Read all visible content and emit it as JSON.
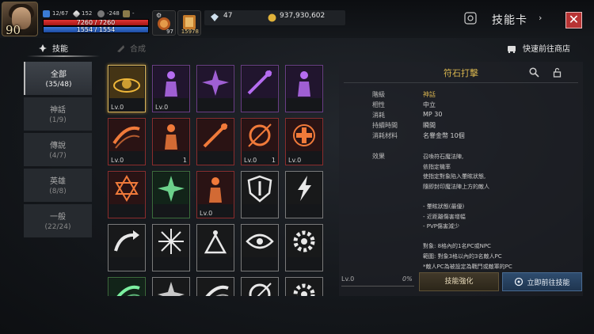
{
  "hud": {
    "level": "90",
    "stat_a": "12/67",
    "stat_b": "152",
    "stat_c": "-248",
    "stat_d": "-",
    "hp": "7260 / 7260",
    "mp": "1554 / 1554",
    "hp_fraction": 1.0,
    "mp_fraction": 1.0,
    "slot1_count": "97",
    "slot2_count": "15978",
    "crystal": "47",
    "gold": "937,930,602"
  },
  "header": {
    "title": "技能卡",
    "close_label": "✕"
  },
  "tabs": [
    {
      "label": "技能",
      "active": true
    },
    {
      "label": "合成",
      "active": false
    }
  ],
  "shop_link": "快速前往商店",
  "categories": [
    {
      "name": "全部",
      "count": "(35/48)",
      "active": true
    },
    {
      "name": "神話",
      "count": "(1/9)",
      "active": false
    },
    {
      "name": "傳說",
      "count": "(4/7)",
      "active": false
    },
    {
      "name": "英雄",
      "count": "(8/8)",
      "active": false
    },
    {
      "name": "一般",
      "count": "(22/24)",
      "active": false
    }
  ],
  "cards": [
    {
      "lv": "Lv.0",
      "qty": "",
      "rarity": "gold",
      "glyph": "gold-rune",
      "selected": true
    },
    {
      "lv": "Lv.0",
      "qty": "",
      "rarity": "purple",
      "glyph": "figure"
    },
    {
      "lv": "",
      "qty": "",
      "rarity": "purple",
      "glyph": "burst"
    },
    {
      "lv": "",
      "qty": "",
      "rarity": "purple",
      "glyph": "weapon"
    },
    {
      "lv": "",
      "qty": "",
      "rarity": "purple",
      "glyph": "figure"
    },
    {
      "lv": "Lv.0",
      "qty": "",
      "rarity": "red",
      "glyph": "slash"
    },
    {
      "lv": "",
      "qty": "1",
      "rarity": "red",
      "glyph": "figure"
    },
    {
      "lv": "",
      "qty": "",
      "rarity": "red",
      "glyph": "weapon"
    },
    {
      "lv": "Lv.0",
      "qty": "1",
      "rarity": "red",
      "glyph": "orb"
    },
    {
      "lv": "Lv.0",
      "qty": "",
      "rarity": "red",
      "glyph": "cross"
    },
    {
      "lv": "",
      "qty": "",
      "rarity": "red",
      "glyph": "star"
    },
    {
      "lv": "",
      "qty": "",
      "rarity": "green",
      "glyph": "burst"
    },
    {
      "lv": "Lv.0",
      "qty": "",
      "rarity": "red",
      "glyph": "figure"
    },
    {
      "lv": "",
      "qty": "",
      "rarity": "white",
      "glyph": "shield"
    },
    {
      "lv": "",
      "qty": "",
      "rarity": "white",
      "glyph": "bolt"
    },
    {
      "lv": "",
      "qty": "",
      "rarity": "white",
      "glyph": "arrow"
    },
    {
      "lv": "",
      "qty": "",
      "rarity": "white",
      "glyph": "spark"
    },
    {
      "lv": "",
      "qty": "",
      "rarity": "white",
      "glyph": "aura"
    },
    {
      "lv": "",
      "qty": "",
      "rarity": "white",
      "glyph": "eye"
    },
    {
      "lv": "",
      "qty": "",
      "rarity": "white",
      "glyph": "gear"
    },
    {
      "lv": "",
      "qty": "",
      "rarity": "green",
      "glyph": "slash"
    },
    {
      "lv": "",
      "qty": "",
      "rarity": "white",
      "glyph": "burst"
    },
    {
      "lv": "",
      "qty": "",
      "rarity": "white",
      "glyph": "slash"
    },
    {
      "lv": "",
      "qty": "",
      "rarity": "white",
      "glyph": "orb"
    },
    {
      "lv": "",
      "qty": "",
      "rarity": "white",
      "glyph": "gear"
    }
  ],
  "detail": {
    "name": "符石打擊",
    "props": [
      {
        "label": "階級",
        "value": "神話",
        "gold": true
      },
      {
        "label": "相性",
        "value": "中立",
        "gold": false
      },
      {
        "label": "消耗",
        "value": "MP 30",
        "gold": false
      },
      {
        "label": "持續時間",
        "value": "瞬間",
        "gold": false
      },
      {
        "label": "消耗材料",
        "value": "名譽金幣 10個",
        "gold": false
      }
    ],
    "effect_label": "效果",
    "effect_lines": [
      "召喚符石魔法陣,",
      "依指定機率",
      "使指定對象陷入暈眩狀態,",
      "隨即封印魔法陣上方的敵人",
      "",
      "- 暈眩狀態(最優)",
      "- 近距離傷害增幅",
      "- PVP傷害減少",
      "",
      "對象: 8格內的1名PC或NPC",
      "範圍: 對象3格以內的3名敵人PC",
      "*敵人PC為被設定為戰鬥或敵軍的PC"
    ],
    "level": "Lv.0",
    "percent": "0%",
    "enhance_label": "技能強化",
    "goto_label": "立即前往技能"
  }
}
